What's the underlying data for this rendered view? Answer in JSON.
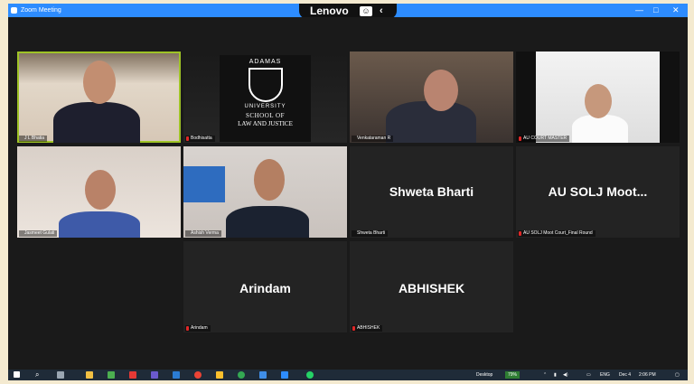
{
  "window": {
    "title": "Zoom Meeting"
  },
  "lenovo_bar": {
    "brand": "Lenovo"
  },
  "participants": [
    {
      "name": "J L Bhatia"
    },
    {
      "name": "Bodhisatta"
    },
    {
      "name": "Venkataraman R"
    },
    {
      "name": "AU COURT MASTER"
    },
    {
      "name": "Jasmeet Gulati"
    },
    {
      "name": "Ashish Verma"
    },
    {
      "name": "Shweta Bharti",
      "display": "Shweta Bharti"
    },
    {
      "name": "AU SOLJ Moot Court_Final Round",
      "display": "AU SOLJ Moot..."
    },
    {
      "name": "Arindam",
      "display": "Arindam"
    },
    {
      "name": "ABHISHEK",
      "display": "ABHISHEK"
    }
  ],
  "logo": {
    "top": "ADAMAS",
    "middle": "UNIVERSITY",
    "line1": "SCHOOL OF",
    "line2": "LAW AND JUSTICE"
  },
  "taskbar": {
    "desktop_label": "Desktop",
    "battery": "79%",
    "language": "ENG",
    "date": "Dec 4",
    "time": "2:06 PM"
  }
}
